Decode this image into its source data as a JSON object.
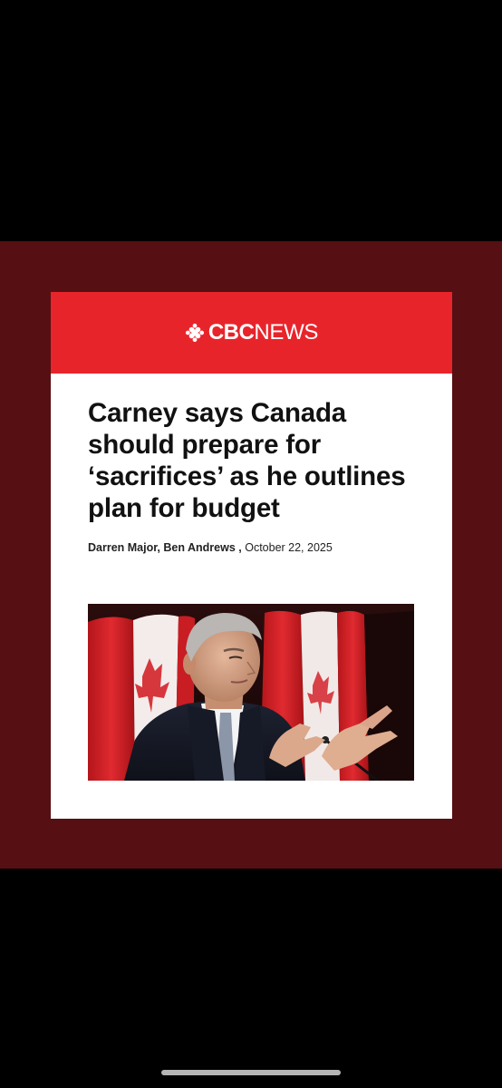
{
  "brand": {
    "logo_cbc": "CBC",
    "logo_news": "NEWS"
  },
  "article": {
    "headline": "Carney says Canada should prepare for ‘sacrifices’ as he outlines plan for budget",
    "authors": "Darren Major, Ben Andrews ,",
    "date": "October 22, 2025"
  },
  "colors": {
    "background": "#000000",
    "maroon_band": "#560f12",
    "cbc_red": "#e8242b",
    "card": "#ffffff"
  },
  "icons": [
    "cbc-gem-icon"
  ]
}
